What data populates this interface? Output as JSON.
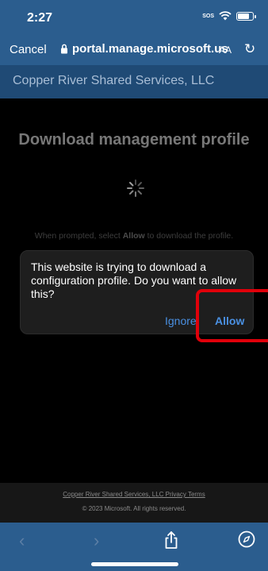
{
  "status": {
    "time": "2:27",
    "sos": "SOS"
  },
  "browser": {
    "cancel_label": "Cancel",
    "url": "portal.manage.microsoft.us",
    "text_size_label": "AA",
    "reload_icon": "reload-icon"
  },
  "org": {
    "name": "Copper River Shared Services, LLC"
  },
  "main": {
    "heading": "Download management profile",
    "prompt_before": "When prompted, select ",
    "prompt_bold": "Allow",
    "prompt_after": " to download the profile."
  },
  "dialog": {
    "message": "This website is trying to download a configuration profile. Do you want to allow this?",
    "ignore_label": "Ignore",
    "allow_label": "Allow"
  },
  "footer": {
    "links": "Copper River Shared Services, LLC Privacy Terms",
    "copyright": "© 2023 Microsoft. All rights reserved."
  },
  "toolbar": {
    "back_icon": "chevron-left-icon",
    "forward_icon": "chevron-right-icon",
    "share_icon": "share-icon",
    "compass_icon": "compass-icon"
  },
  "colors": {
    "bar_blue": "#2b5d8e",
    "org_blue": "#1f4a75",
    "link_blue": "#4a90e2",
    "highlight_red": "#e0000a"
  }
}
